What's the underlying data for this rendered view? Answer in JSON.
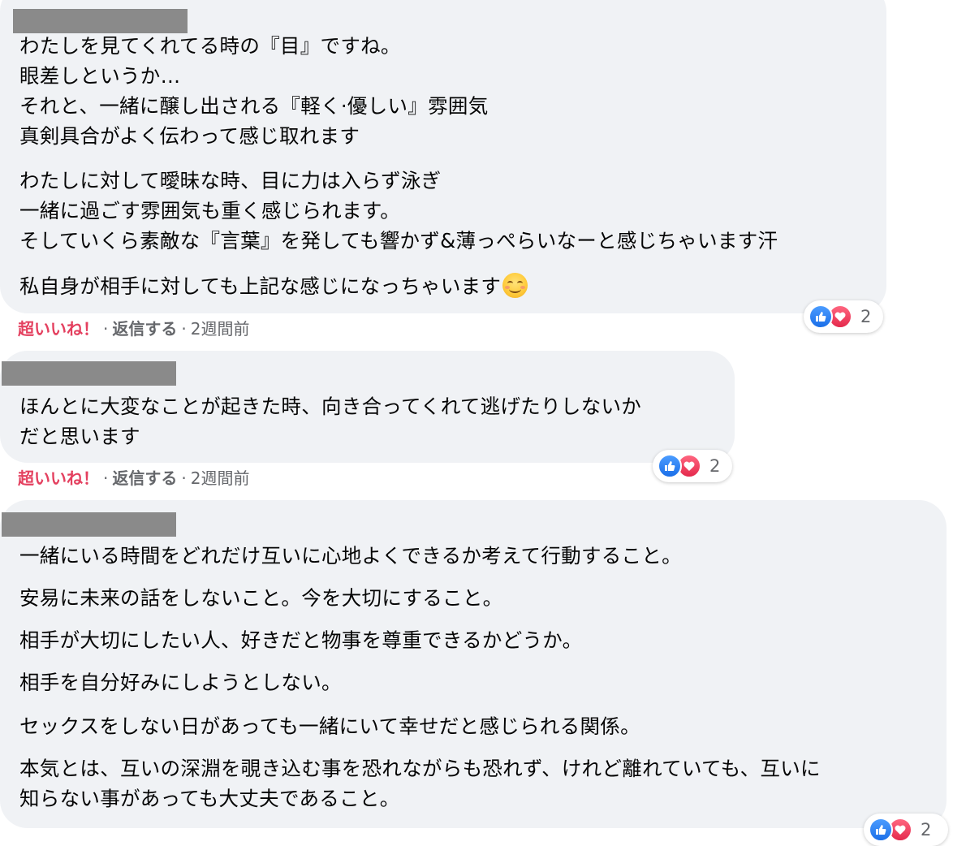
{
  "comments": [
    {
      "paragraphs": [
        "わたしを見てくれてる時の『目』ですね。\n眼差しというか…\nそれと、一緒に醸し出される『軽く·優しい』雰囲気\n真剣具合がよく伝わって感じ取れます",
        "わたしに対して曖昧な時、目に力は入らず泳ぎ\n一緒に過ごす雰囲気も重く感じられます。\nそしていくら素敵な『言葉』を発しても響かず&薄っぺらいなーと感じちゃいます汗",
        "私自身が相手に対しても上記な感じになっちゃいます"
      ],
      "emoji": "smiling-face-icon",
      "reaction_count": "2",
      "actions": {
        "super_like": "超いいね！",
        "reply": "返信する",
        "time": "2週間前"
      }
    },
    {
      "paragraphs": [
        "ほんとに大変なことが起きた時、向き合ってくれて逃げたりしないか\nだと思います"
      ],
      "reaction_count": "2",
      "actions": {
        "super_like": "超いいね！",
        "reply": "返信する",
        "time": "2週間前"
      }
    },
    {
      "paragraphs": [
        "一緒にいる時間をどれだけ互いに心地よくできるか考えて行動すること。",
        "安易に未来の話をしないこと。今を大切にすること。",
        "相手が大切にしたい人、好きだと物事を尊重できるかどうか。",
        "相手を自分好みにしようとしない。",
        "セックスをしない日があっても一緒にいて幸せだと感じられる関係。",
        "本気とは、互いの深淵を覗き込む事を恐れながらも恐れず、けれど離れていても、互いに\n知らない事があっても大丈夫であること。"
      ],
      "reaction_count": "2"
    }
  ],
  "colors": {
    "bubble": "#f0f2f5",
    "text": "#050505",
    "secondary": "#65676b",
    "super_like": "#e4405f",
    "like_blue": "#1b6fe8",
    "love_red": "#e4294c"
  }
}
